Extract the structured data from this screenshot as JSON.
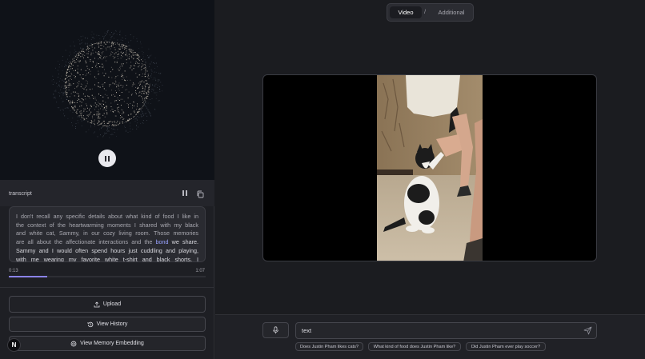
{
  "transcript": {
    "label": "transcript",
    "text_before": "I don't recall any specific details about what kind of food I like in the context of the heartwarming moments I shared with my black and white cat, Sammy, in our cozy living room. Those memories are all about the affectionate interactions and the ",
    "highlight": "bond",
    "text_after": " we share. Sammy and I would often spend hours just cuddling and playing, with me wearing my favorite white t-shirt and black shorts. I remember the",
    "current_time": "0:13",
    "total_time": "1:07",
    "progress": 0.194
  },
  "actions": {
    "upload": "Upload",
    "history": "View History",
    "memory": "View Memory Embedding"
  },
  "badge_letter": "N",
  "toggle": {
    "video": "Video",
    "separator": "/",
    "additional": "Additional"
  },
  "chat": {
    "input_value": "text"
  },
  "suggestions": [
    "Does Justin Pham likes cats?",
    "What kind of food does Justin Pham like?",
    "Did Justin Pham ever play soccer?"
  ],
  "icons": {
    "visualizer": "particle-sphere",
    "pause": "pause-icon",
    "copy": "copy-icon",
    "upload": "upload-icon",
    "history": "history-icon",
    "memory": "brain-icon",
    "mic": "mic-icon",
    "send": "send-icon"
  },
  "colors": {
    "accent": "#8a82e8",
    "highlight": "#9aa3ff",
    "particles": "#e6dccb"
  }
}
